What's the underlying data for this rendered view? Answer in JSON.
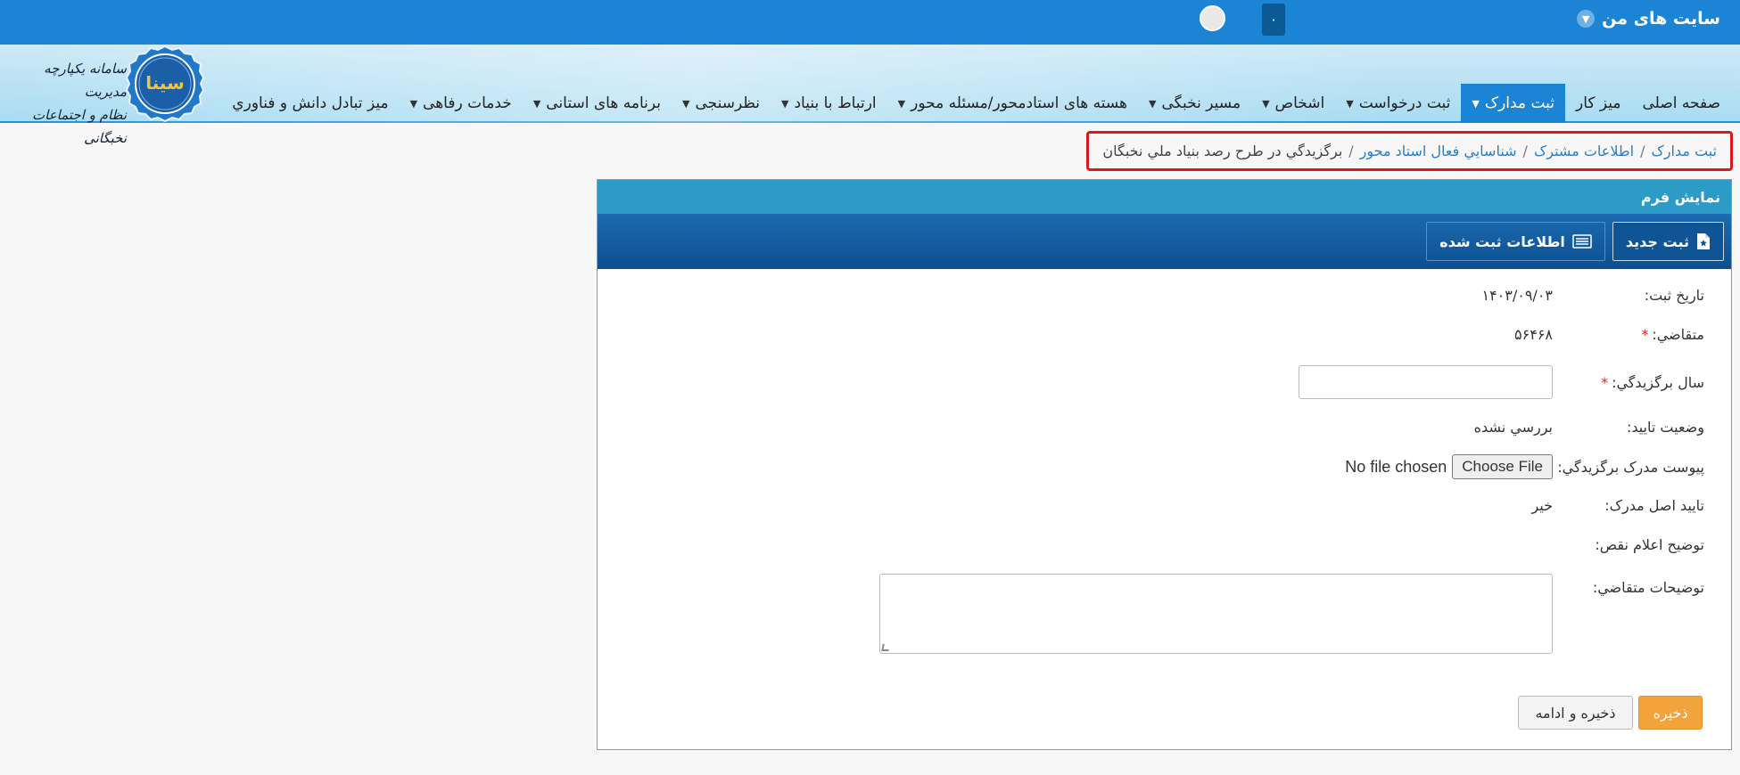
{
  "topbar": {
    "my_sites": "سایت های من",
    "notification_count": "۰"
  },
  "logo": {
    "line1": "سامانه یکپارچه مدیریت",
    "line2": "نظام و اجتماعات نخبگانی",
    "seal_text": "سینا"
  },
  "nav": {
    "items": [
      {
        "label": "صفحه اصلی",
        "has_caret": false,
        "active": false
      },
      {
        "label": "میز کار",
        "has_caret": false,
        "active": false
      },
      {
        "label": "ثبت مدارک",
        "has_caret": true,
        "active": true
      },
      {
        "label": "ثبت درخواست",
        "has_caret": true,
        "active": false
      },
      {
        "label": "اشخاص",
        "has_caret": true,
        "active": false
      },
      {
        "label": "مسیر نخبگی",
        "has_caret": true,
        "active": false
      },
      {
        "label": "هسته های استادمحور/مسئله محور",
        "has_caret": true,
        "active": false
      },
      {
        "label": "ارتباط با بنیاد",
        "has_caret": true,
        "active": false
      },
      {
        "label": "نظرسنجی",
        "has_caret": true,
        "active": false
      },
      {
        "label": "برنامه های استانی",
        "has_caret": true,
        "active": false
      },
      {
        "label": "خدمات رفاهی",
        "has_caret": true,
        "active": false
      },
      {
        "label": "میز تبادل دانش و فناوري",
        "has_caret": false,
        "active": false
      }
    ]
  },
  "breadcrumb": {
    "items": [
      "ثبت مدارک",
      "اطلاعات مشترک",
      "شناسايي فعال استاد محور"
    ],
    "current": "برگزيدگي در طرح رصد بنياد ملي نخبگان",
    "separator": "/"
  },
  "panel": {
    "title": "نمایش فرم",
    "new_button": "ثبت جدید",
    "registered_button": "اطلاعات ثبت شده"
  },
  "form": {
    "reg_date_label": "تاریخ ثبت:",
    "reg_date_value": "۱۴۰۳/۰۹/۰۳",
    "applicant_label": "متقاضي:",
    "applicant_value": "۵۶۴۶۸",
    "year_label": "سال برگزيدگي:",
    "year_value": "",
    "status_label": "وضعیت تایید:",
    "status_value": "بررسي نشده",
    "attach_label": "پیوست مدرک برگزيدگي:",
    "choose_file": "Choose File",
    "no_file": "No file chosen",
    "original_label": "تایید اصل مدرک:",
    "original_value": "خیر",
    "defect_label": "توضیح اعلام نقص:",
    "notes_label": "توضیحات متقاضي:",
    "required_mark": "*"
  },
  "actions": {
    "save": "ذخیره",
    "save_continue": "ذخیره و ادامه"
  },
  "colors": {
    "primary_blue": "#1b84d4",
    "toolbar_blue": "#0c4f8f",
    "highlight_red": "#d91a1a",
    "save_orange": "#f2a33a"
  }
}
